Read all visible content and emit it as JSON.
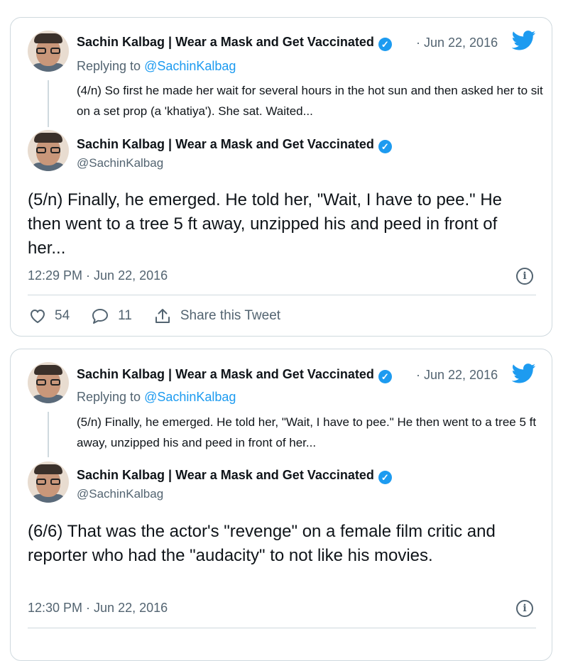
{
  "cards": [
    {
      "quoted": {
        "name": "Sachin Kalbag | Wear a Mask and Get Vaccinated",
        "date": "· Jun 22, 2016",
        "replying_label": "Replying to",
        "replying_to": "@SachinKalbag",
        "text": "(4/n) So first he made her wait for several hours in the hot sun and then asked her to sit on a set prop (a 'khatiya'). She sat. Waited..."
      },
      "tweet": {
        "name": "Sachin Kalbag | Wear a Mask and Get Vaccinated",
        "handle": "@SachinKalbag",
        "text": "(5/n) Finally, he emerged. He told her, \"Wait, I have to pee.\" He then went to a tree 5 ft away, unzipped his and peed in front of her...",
        "time": "12:29 PM · Jun 22, 2016"
      },
      "actions": {
        "likes": "54",
        "replies": "11",
        "share": "Share this Tweet"
      }
    },
    {
      "quoted": {
        "name": "Sachin Kalbag | Wear a Mask and Get Vaccinated",
        "date": "· Jun 22, 2016",
        "replying_label": "Replying to",
        "replying_to": "@SachinKalbag",
        "text": "(5/n) Finally, he emerged. He told her, \"Wait, I have to pee.\" He then went to a tree 5 ft away, unzipped his and peed in front of her..."
      },
      "tweet": {
        "name": "Sachin Kalbag | Wear a Mask and Get Vaccinated",
        "handle": "@SachinKalbag",
        "text": "(6/6) That was the actor's \"revenge\" on a female film critic and reporter who had the \"audacity\" to not like his movies.",
        "time": "12:30 PM · Jun 22, 2016"
      }
    }
  ],
  "icons": {
    "verified": "verified-check-icon",
    "bird": "twitter-bird-icon",
    "info": "info-icon",
    "like": "heart-icon",
    "reply": "speech-bubble-icon",
    "share": "share-arrow-icon"
  },
  "colors": {
    "accent": "#1d9bf0",
    "muted": "#536471",
    "border": "#cfd9de"
  }
}
